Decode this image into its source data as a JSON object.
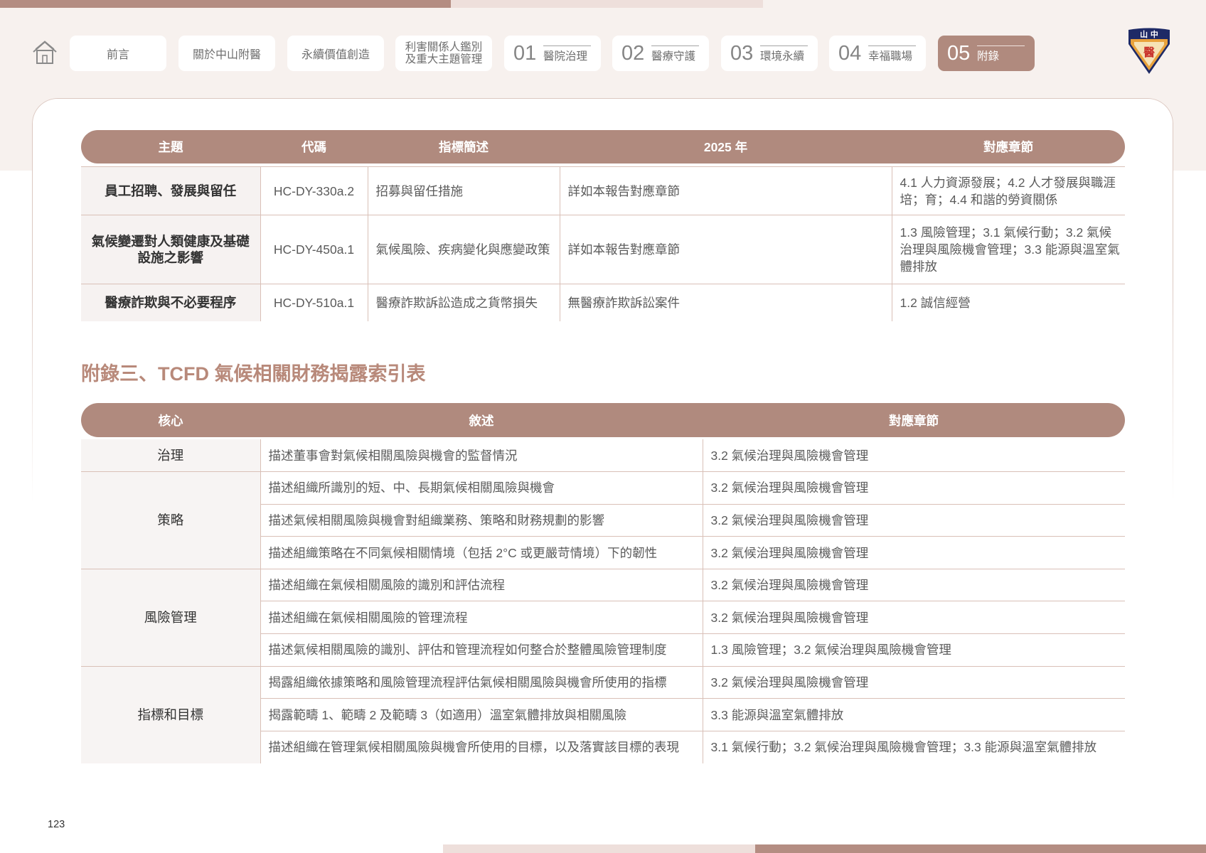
{
  "colors": {
    "accent": "#b08a7e",
    "accent_dark": "#b48d82",
    "accent_light": "#eedfdb",
    "background_band": "#f7f1ee",
    "section_title": "#b8897a",
    "grid_line": "#d9c0b7"
  },
  "nav": {
    "home_icon": "home-icon",
    "items": [
      {
        "label": "前言"
      },
      {
        "label": "關於中山附醫"
      },
      {
        "label": "永續價值創造"
      },
      {
        "label_line1": "利害關係人鑑別",
        "label_line2": "及重大主題管理"
      },
      {
        "number": "01",
        "label": "醫院治理"
      },
      {
        "number": "02",
        "label": "醫療守護"
      },
      {
        "number": "03",
        "label": "環境永續"
      },
      {
        "number": "04",
        "label": "幸福職場"
      },
      {
        "number": "05",
        "label": "附錄",
        "active": true
      }
    ]
  },
  "logo": {
    "top_text": "山 中",
    "emblem_text": "醫"
  },
  "table1": {
    "headers": [
      "主題",
      "代碼",
      "指標簡述",
      "2025 年",
      "對應章節"
    ],
    "rows": [
      {
        "topic": "員工招聘、發展與留任",
        "code": "HC-DY-330a.2",
        "metric": "招募與留任措施",
        "year_2025": "詳如本報告對應章節",
        "chapter": "4.1 人力資源發展；4.2 人才發展與職涯培；育；4.4 和諧的勞資關係"
      },
      {
        "topic": "氣候變遷對人類健康及基礎設施之影響",
        "code": "HC-DY-450a.1",
        "metric": "氣候風險、疾病變化與應變政策",
        "year_2025": "詳如本報告對應章節",
        "chapter": "1.3 風險管理；3.1 氣候行動；3.2 氣候治理與風險機會管理；3.3 能源與溫室氣體排放"
      },
      {
        "topic": "醫療詐欺與不必要程序",
        "code": "HC-DY-510a.1",
        "metric": "醫療詐欺訴訟造成之貨幣損失",
        "year_2025": "無醫療詐欺訴訟案件",
        "chapter": "1.2 誠信經營"
      }
    ]
  },
  "section_title": "附錄三、TCFD 氣候相關財務揭露索引表",
  "table2": {
    "headers": [
      "核心",
      "敘述",
      "對應章節"
    ],
    "groups": [
      {
        "core": "治理",
        "rows": [
          {
            "description": "描述董事會對氣候相關風險與機會的監督情況",
            "chapter": "3.2 氣候治理與風險機會管理"
          }
        ]
      },
      {
        "core": "策略",
        "rows": [
          {
            "description": "描述組織所識別的短、中、長期氣候相關風險與機會",
            "chapter": "3.2 氣候治理與風險機會管理"
          },
          {
            "description": "描述氣候相關風險與機會對組織業務、策略和財務規劃的影響",
            "chapter": "3.2 氣候治理與風險機會管理"
          },
          {
            "description": "描述組織策略在不同氣候相關情境（包括 2°C 或更嚴苛情境）下的韌性",
            "chapter": "3.2 氣候治理與風險機會管理"
          }
        ]
      },
      {
        "core": "風險管理",
        "rows": [
          {
            "description": "描述組織在氣候相關風險的識別和評估流程",
            "chapter": "3.2 氣候治理與風險機會管理"
          },
          {
            "description": "描述組織在氣候相關風險的管理流程",
            "chapter": "3.2 氣候治理與風險機會管理"
          },
          {
            "description": "描述氣候相關風險的識別、評估和管理流程如何整合於整體風險管理制度",
            "chapter": "1.3 風險管理；3.2 氣候治理與風險機會管理"
          }
        ]
      },
      {
        "core": "指標和目標",
        "rows": [
          {
            "description": "揭露組織依據策略和風險管理流程評估氣候相關風險與機會所使用的指標",
            "chapter": "3.2 氣候治理與風險機會管理"
          },
          {
            "description": "揭露範疇 1、範疇 2 及範疇 3（如適用）溫室氣體排放與相關風險",
            "chapter": "3.3 能源與溫室氣體排放"
          },
          {
            "description": "描述組織在管理氣候相關風險與機會所使用的目標，以及落實該目標的表現",
            "chapter": "3.1 氣候行動；3.2 氣候治理與風險機會管理；3.3 能源與溫室氣體排放"
          }
        ]
      }
    ]
  },
  "page_number": "123"
}
